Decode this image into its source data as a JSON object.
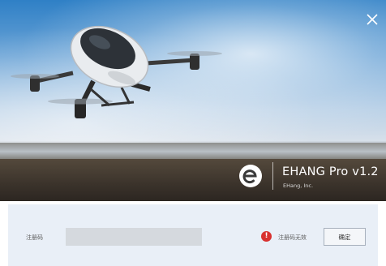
{
  "app": {
    "product_name": "EHANG Pro v1.2",
    "company": "EHang, Inc."
  },
  "hero": {
    "illustration": "passenger-drone-over-landscape"
  },
  "registration": {
    "label": "注册码",
    "input_value": "",
    "input_placeholder": "",
    "status_text": "注册码无效",
    "confirm_label": "确定"
  },
  "icons": {
    "close": "close-icon",
    "logo": "ehang-logo-icon",
    "warning": "warning-icon"
  },
  "colors": {
    "warning": "#d8312f",
    "panel_bg": "#e9eff7",
    "input_bg": "#d5d9de"
  }
}
